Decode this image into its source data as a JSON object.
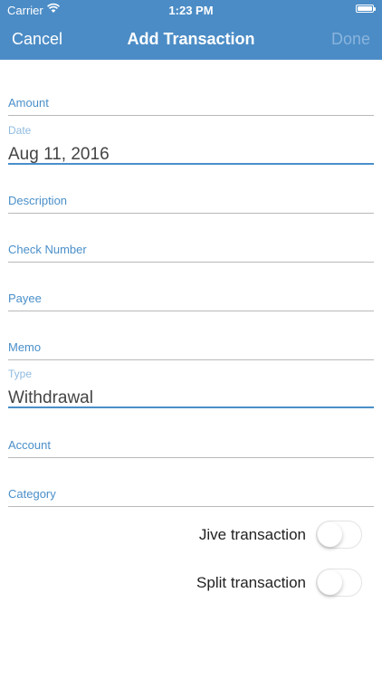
{
  "status_bar": {
    "carrier": "Carrier",
    "time": "1:23 PM"
  },
  "nav": {
    "cancel": "Cancel",
    "title": "Add Transaction",
    "done": "Done"
  },
  "fields": {
    "amount": {
      "label": "Amount"
    },
    "date": {
      "label": "Date",
      "value": "Aug 11, 2016"
    },
    "description": {
      "label": "Description"
    },
    "check_number": {
      "label": "Check Number"
    },
    "payee": {
      "label": "Payee"
    },
    "memo": {
      "label": "Memo"
    },
    "type": {
      "label": "Type",
      "value": "Withdrawal"
    },
    "account": {
      "label": "Account"
    },
    "category": {
      "label": "Category"
    }
  },
  "toggles": {
    "jive": {
      "label": "Jive transaction",
      "on": false
    },
    "split": {
      "label": "Split transaction",
      "on": false
    }
  },
  "colors": {
    "header": "#4b8cc6",
    "accent": "#4a8fc9"
  }
}
